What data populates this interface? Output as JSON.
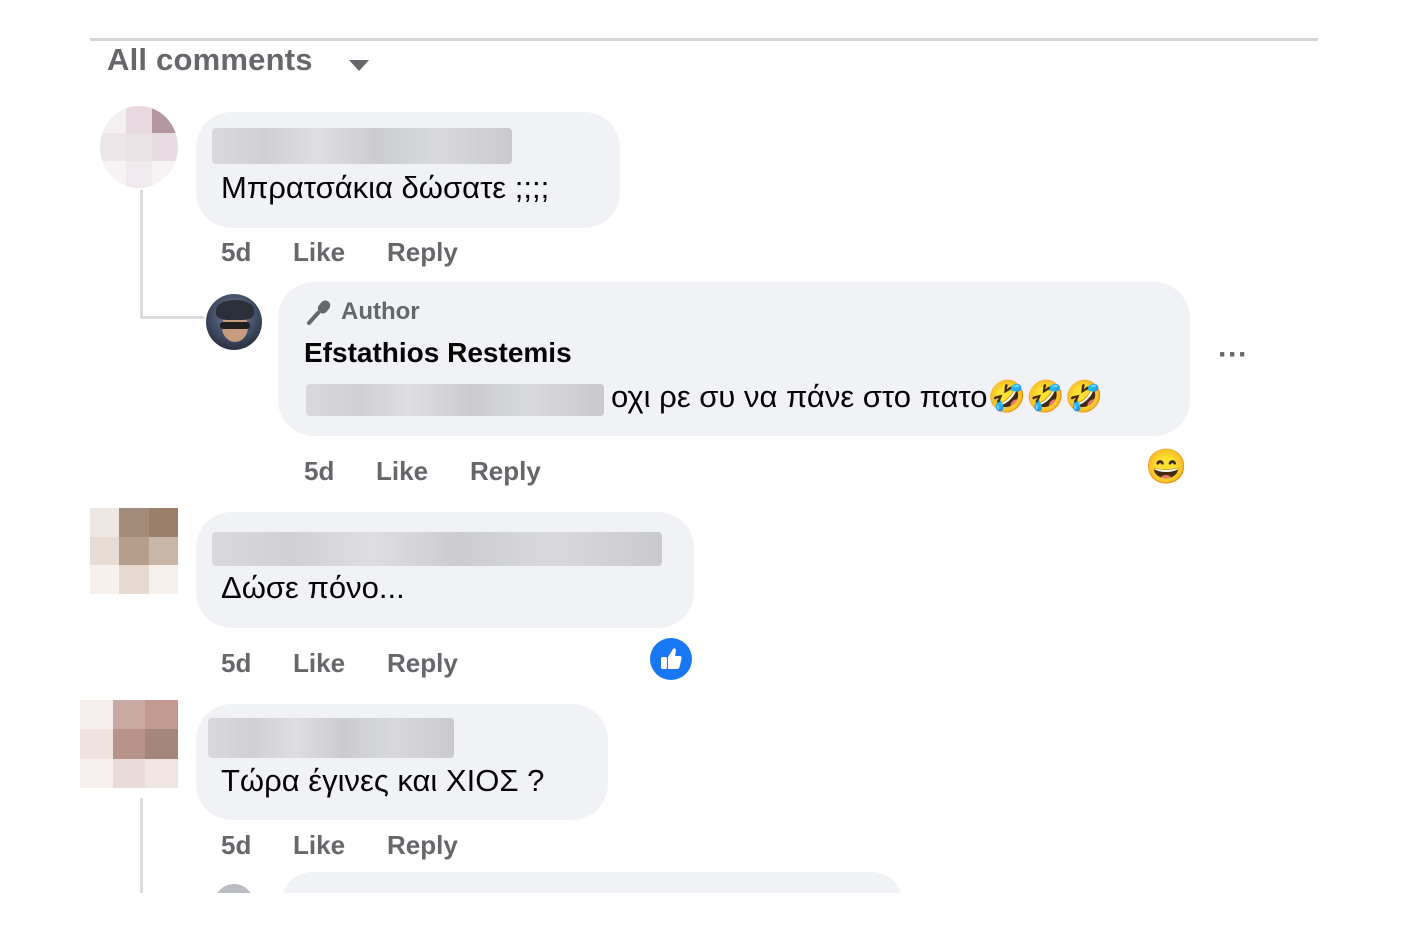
{
  "header": {
    "sort_label": "All comments"
  },
  "comments": [
    {
      "text": "Μπρατσάκια δώσατε ;;;;",
      "time": "5d",
      "like": "Like",
      "reply": "Reply"
    },
    {
      "badge": "Author",
      "name": "Efstathios Restemis",
      "text": "οχι ρε συ να πάνε στο πατο🤣🤣🤣",
      "time": "5d",
      "like": "Like",
      "reply": "Reply",
      "more": "···",
      "reaction": "😄"
    },
    {
      "text": "Δώσε πόνο...",
      "time": "5d",
      "like": "Like",
      "reply": "Reply",
      "reaction": "like"
    },
    {
      "text": "Τώρα έγινες και ΧΙΟΣ ?",
      "time": "5d",
      "like": "Like",
      "reply": "Reply"
    }
  ],
  "colors": {
    "bubble": "#f0f2f5",
    "meta_text": "#65676b",
    "like_blue": "#1877f2"
  }
}
